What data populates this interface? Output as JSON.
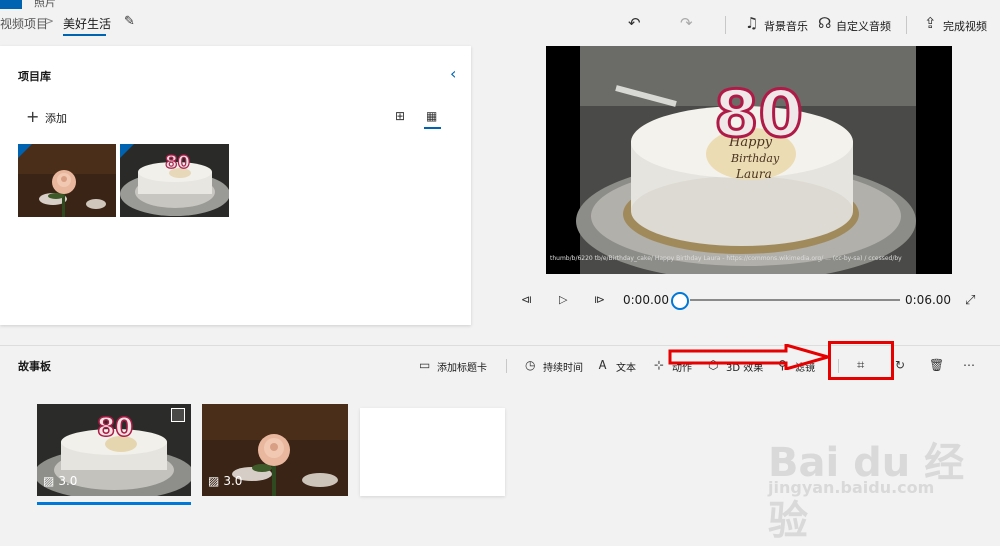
{
  "titlebar": {
    "app_title": "照片"
  },
  "breadcrumb": {
    "previous": "视频项目",
    "separator": ">",
    "current": "美好生活"
  },
  "toolbar": {
    "music_label": "背景音乐",
    "custom_audio_label": "自定义音频",
    "finish_label": "完成视频"
  },
  "library": {
    "title": "项目库",
    "add_label": "添加"
  },
  "preview": {
    "caption": "thumb/b/6220 tb/e/Birthday_cake/ Happy Birthday Laura - https://commons.wikimedia.org/ ... (cc-by-sa) / ccessed/by",
    "current_time": "0:00.00",
    "total_time": "0:06.00",
    "progress": 0
  },
  "storyboard": {
    "title": "故事板",
    "tools": {
      "title_card": "添加标题卡",
      "duration": "持续时间",
      "text": "文本",
      "motion": "动作",
      "effects_3d": "3D 效果",
      "filters": "滤镜"
    },
    "clips": [
      {
        "duration": "3.0"
      },
      {
        "duration": "3.0"
      }
    ]
  },
  "watermark": {
    "brand": "Bai du 经验",
    "url": "jingyan.baidu.com"
  },
  "colors": {
    "accent": "#0063b1",
    "highlight": "#e60000"
  }
}
